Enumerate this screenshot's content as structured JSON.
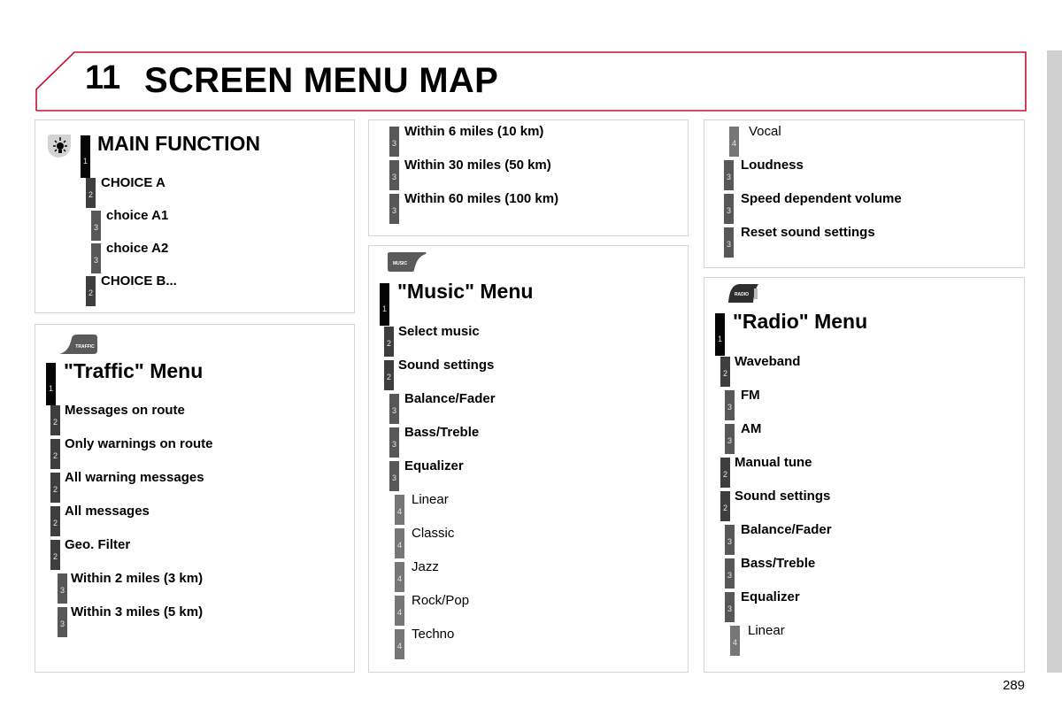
{
  "header": {
    "chapter_number": "11",
    "title": "SCREEN MENU MAP"
  },
  "colors": {
    "header_border": "#c8102e",
    "level1": "#050505",
    "level2": "#3e3e3e",
    "level3": "#575757",
    "level4": "#767676",
    "side_strip": "#cfcfd0"
  },
  "panels": {
    "main_function": {
      "icon": "light-bulb-icon",
      "items": [
        {
          "level": "1",
          "label": "MAIN FUNCTION"
        },
        {
          "level": "2",
          "label": "CHOICE A"
        },
        {
          "level": "3",
          "label": "choice A1"
        },
        {
          "level": "3",
          "label": "choice A2"
        },
        {
          "level": "2",
          "label": "CHOICE B..."
        }
      ]
    },
    "traffic": {
      "icon": "traffic-button-icon",
      "icon_text": "TRAFFIC",
      "items": [
        {
          "level": "1",
          "label": "\"Traffic\" Menu"
        },
        {
          "level": "2",
          "label": "Messages on route"
        },
        {
          "level": "2",
          "label": "Only warnings on route"
        },
        {
          "level": "2",
          "label": "All warning messages"
        },
        {
          "level": "2",
          "label": "All messages"
        },
        {
          "level": "2",
          "label": "Geo. Filter"
        },
        {
          "level": "3",
          "label": "Within 2 miles (3 km)"
        },
        {
          "level": "3",
          "label": "Within 3 miles (5 km)"
        }
      ]
    },
    "traffic_cont": {
      "items": [
        {
          "level": "3",
          "label": "Within 6 miles (10 km)"
        },
        {
          "level": "3",
          "label": "Within 30 miles (50 km)"
        },
        {
          "level": "3",
          "label": "Within 60 miles (100 km)"
        }
      ]
    },
    "music": {
      "icon": "music-button-icon",
      "icon_text": "MUSIC",
      "items": [
        {
          "level": "1",
          "label": "\"Music\" Menu"
        },
        {
          "level": "2",
          "label": "Select music"
        },
        {
          "level": "2",
          "label": "Sound settings"
        },
        {
          "level": "3",
          "label": "Balance/Fader"
        },
        {
          "level": "3",
          "label": "Bass/Treble"
        },
        {
          "level": "3",
          "label": "Equalizer"
        },
        {
          "level": "4",
          "label": "Linear"
        },
        {
          "level": "4",
          "label": "Classic"
        },
        {
          "level": "4",
          "label": "Jazz"
        },
        {
          "level": "4",
          "label": "Rock/Pop"
        },
        {
          "level": "4",
          "label": "Techno"
        }
      ]
    },
    "music_cont": {
      "items": [
        {
          "level": "4",
          "label": "Vocal"
        },
        {
          "level": "3",
          "label": "Loudness"
        },
        {
          "level": "3",
          "label": "Speed dependent volume"
        },
        {
          "level": "3",
          "label": "Reset sound settings"
        }
      ]
    },
    "radio": {
      "icon": "radio-button-icon",
      "icon_text": "RADIO",
      "items": [
        {
          "level": "1",
          "label": "\"Radio\" Menu"
        },
        {
          "level": "2",
          "label": "Waveband"
        },
        {
          "level": "3",
          "label": "FM"
        },
        {
          "level": "3",
          "label": "AM"
        },
        {
          "level": "2",
          "label": "Manual tune"
        },
        {
          "level": "2",
          "label": "Sound settings"
        },
        {
          "level": "3",
          "label": "Balance/Fader"
        },
        {
          "level": "3",
          "label": "Bass/Treble"
        },
        {
          "level": "3",
          "label": "Equalizer"
        },
        {
          "level": "4",
          "label": "Linear"
        }
      ]
    }
  },
  "page_number": "289"
}
